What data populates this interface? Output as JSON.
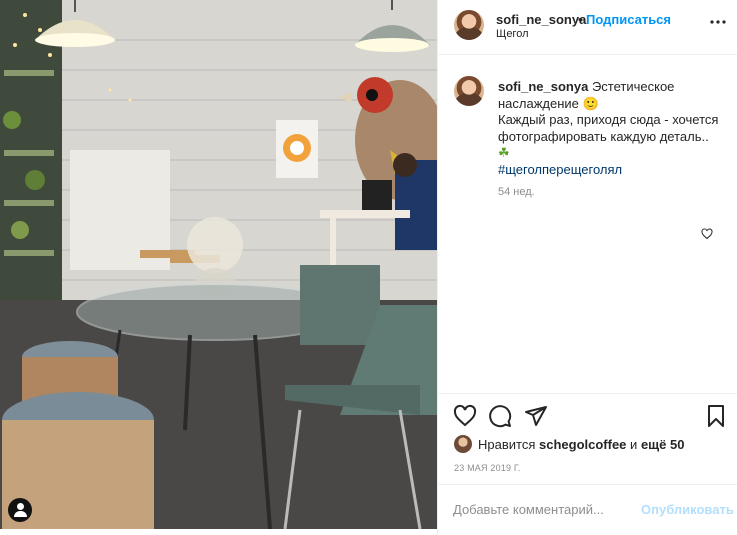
{
  "photo": {
    "alt_subject": "cafe interior"
  },
  "header": {
    "username": "sofi_ne_sonya",
    "separator": "•",
    "follow_label": "Подписаться",
    "location": "Щегол"
  },
  "caption": {
    "username": "sofi_ne_sonya",
    "line1": "Эстетическое наслаждение",
    "emoji": "🙂",
    "line2": "Каждый раз, приходя сюда - хочется фотографировать каждую деталь..",
    "leaf": "☘",
    "hashtag": "#щеголперещеголял",
    "time": "54 нед."
  },
  "likes": {
    "prefix": "Нравится",
    "liker": "schegolcoffee",
    "and": "и",
    "count_text": "ещё 50"
  },
  "date": "23 МАЯ 2019 Г.",
  "comment_box": {
    "placeholder": "Добавьте комментарий...",
    "publish_label": "Опубликовать"
  },
  "colors": {
    "link_blue": "#0095f6",
    "hashtag_blue": "#00376b",
    "muted": "#8e8e8e",
    "publish_disabled": "#b2dffc"
  },
  "icons": [
    "more-icon",
    "heart-icon",
    "comment-icon",
    "share-icon",
    "bookmark-icon",
    "user-tag-icon"
  ]
}
